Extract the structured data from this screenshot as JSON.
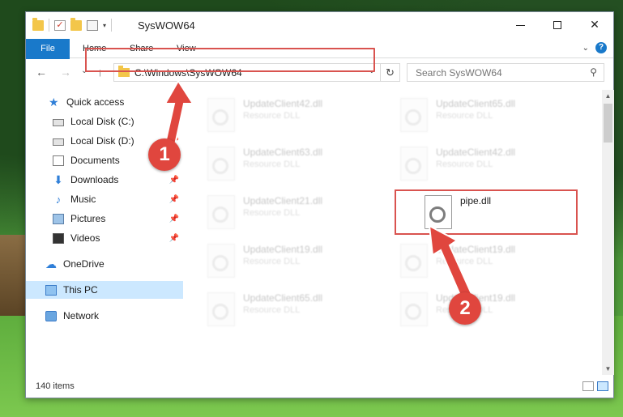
{
  "window": {
    "title": "SysWOW64"
  },
  "window_buttons": {
    "minimize": "",
    "maximize": "",
    "close": "✕"
  },
  "ribbon": {
    "tabs": [
      "File",
      "Home",
      "Share",
      "View"
    ]
  },
  "nav": {
    "back": "←",
    "forward": "→",
    "recent": "⌄",
    "up": "↑",
    "address": "C:\\Windows\\SysWOW64",
    "search_placeholder": "Search SysWOW64"
  },
  "sidebar": {
    "items": [
      {
        "label": "Quick access",
        "icon": "star-icon",
        "pinned": false
      },
      {
        "label": "Local Disk (C:)",
        "icon": "disk-icon",
        "pinned": true
      },
      {
        "label": "Local Disk (D:)",
        "icon": "disk-icon",
        "pinned": true
      },
      {
        "label": "Documents",
        "icon": "documents-icon",
        "pinned": true
      },
      {
        "label": "Downloads",
        "icon": "download-icon",
        "pinned": true
      },
      {
        "label": "Music",
        "icon": "music-icon",
        "pinned": true
      },
      {
        "label": "Pictures",
        "icon": "pictures-icon",
        "pinned": true
      },
      {
        "label": "Videos",
        "icon": "videos-icon",
        "pinned": true
      },
      {
        "label": "OneDrive",
        "icon": "cloud-icon",
        "pinned": false
      },
      {
        "label": "This PC",
        "icon": "pc-icon",
        "pinned": false,
        "selected": true
      },
      {
        "label": "Network",
        "icon": "network-icon",
        "pinned": false
      }
    ]
  },
  "files": [
    {
      "name": "UpdateClient42.dll",
      "type": "Resource DLL",
      "blurred": true
    },
    {
      "name": "UpdateClient65.dll",
      "type": "Resource DLL",
      "blurred": true
    },
    {
      "name": "UpdateClient63.dll",
      "type": "Resource DLL",
      "blurred": true
    },
    {
      "name": "UpdateClient42.dll",
      "type": "Resource DLL",
      "blurred": true
    },
    {
      "name": "UpdateClient21.dll",
      "type": "Resource DLL",
      "blurred": true
    },
    {
      "name": "pipe.dll",
      "type": "",
      "blurred": false
    },
    {
      "name": "UpdateClient19.dll",
      "type": "Resource DLL",
      "blurred": true
    },
    {
      "name": "UpdateClient19.dll",
      "type": "Resource DLL",
      "blurred": true
    },
    {
      "name": "UpdateClient65.dll",
      "type": "Resource DLL",
      "blurred": true
    },
    {
      "name": "UpdateClient19.dll",
      "type": "Resource DLL",
      "blurred": true
    }
  ],
  "status": {
    "item_count": "140 items"
  },
  "annotations": {
    "step1": "1",
    "step2": "2",
    "highlight_color": "#d9534f"
  }
}
